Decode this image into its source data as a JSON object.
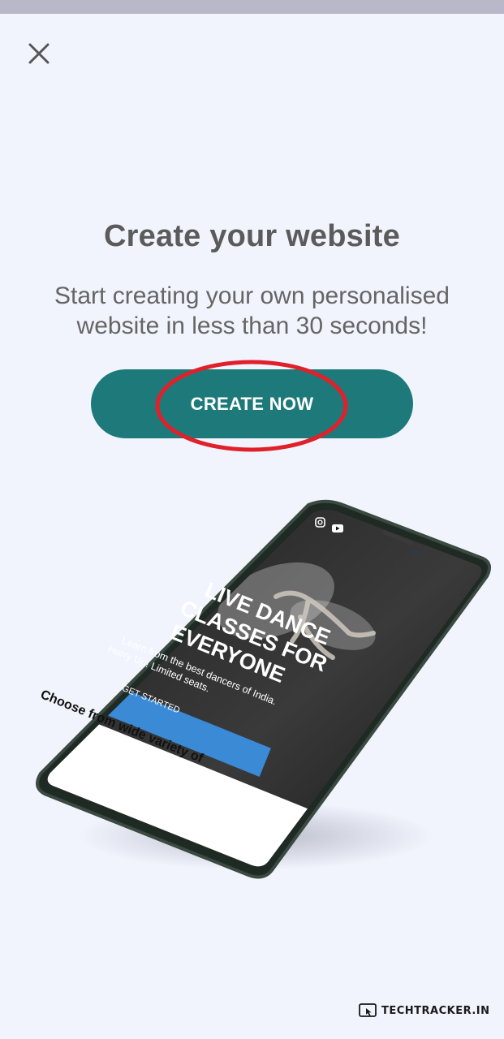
{
  "header": {
    "close_icon": "close-icon"
  },
  "main": {
    "title": "Create your website",
    "subtitle_line1": "Start creating your own personalised",
    "subtitle_line2": "website in less than 30 seconds!",
    "cta_label": "CREATE NOW"
  },
  "phone_preview": {
    "headline_line1": "LIVE DANCE",
    "headline_line2": "CLASSES FOR",
    "headline_line3": "EVERYONE",
    "body_line1": "Learn from the best dancers of India.",
    "body_line2": "Hurry Up! Limited seats.",
    "button_label": "GET STARTED",
    "footer_text": "Choose from wide variety of",
    "icons": [
      "instagram-icon",
      "youtube-icon"
    ]
  },
  "watermark": {
    "text": "TECHTRACKER.IN"
  },
  "colors": {
    "background": "#f1f4fd",
    "cta": "#1e7a7a",
    "annotation": "#e0202a",
    "preview_button": "#3a8ad6"
  }
}
